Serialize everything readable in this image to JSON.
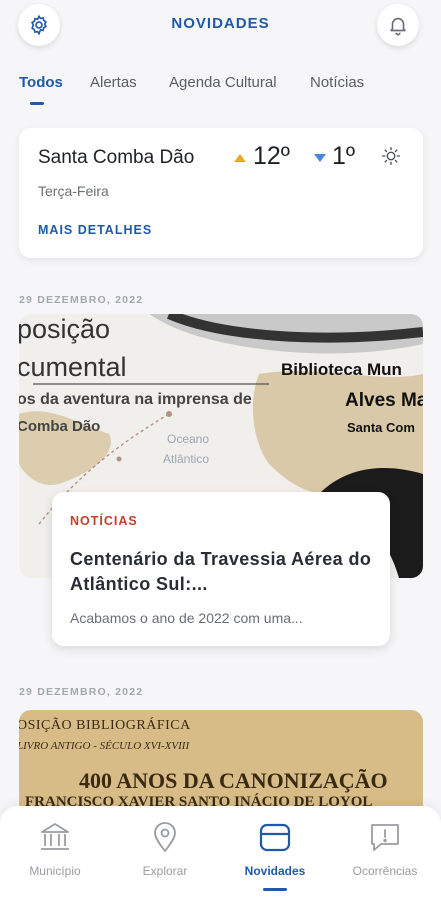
{
  "header": {
    "title": "NOVIDADES"
  },
  "tabs": [
    {
      "label": "Todos",
      "active": true
    },
    {
      "label": "Alertas",
      "active": false
    },
    {
      "label": "Agenda Cultural",
      "active": false
    },
    {
      "label": "Notícias",
      "active": false
    }
  ],
  "weather": {
    "city": "Santa Comba Dão",
    "max_temp": "12º",
    "min_temp": "1º",
    "day": "Terça-Feira",
    "more_label": "MAIS DETALHES",
    "icon": "sun-icon"
  },
  "feed": [
    {
      "date": "29 DEZEMBRO, 2022",
      "image_text": {
        "line1": "posição",
        "line2": "cumental",
        "line3": "os da aventura na imprensa de",
        "line4": "Comba Dão",
        "line5": "Biblioteca Mun",
        "line6": "Alves Ma",
        "line7": "Santa Com",
        "line8": "Oceano",
        "line9": "Atlântico"
      },
      "category": "NOTÍCIAS",
      "title": "Centenário da Travessia Aérea do Atlântico Sul:...",
      "excerpt": "Acabamos o ano de 2022 com uma..."
    },
    {
      "date": "29 DEZEMBRO, 2022",
      "image_text": {
        "line1": "OSIÇÃO BIBLIOGRÁFICA",
        "line2": "LIVRO ANTIGO - SÉCULO XVI-XVIII",
        "line3": "400 ANOS DA CANONIZAÇÃO",
        "line4": "FRANCISCO XAVIER SANTO INÁCIO DE LOYOL"
      }
    }
  ],
  "bottom_nav": [
    {
      "label": "Município",
      "icon": "building-icon",
      "active": false
    },
    {
      "label": "Explorar",
      "icon": "location-pin-icon",
      "active": false
    },
    {
      "label": "Novidades",
      "icon": "news-icon",
      "active": true
    },
    {
      "label": "Ocorrências",
      "icon": "report-icon",
      "active": false
    }
  ],
  "colors": {
    "accent": "#1e5aa8",
    "category": "#c0422c",
    "temp_up": "#e8a92b",
    "temp_down": "#4a86d8"
  }
}
